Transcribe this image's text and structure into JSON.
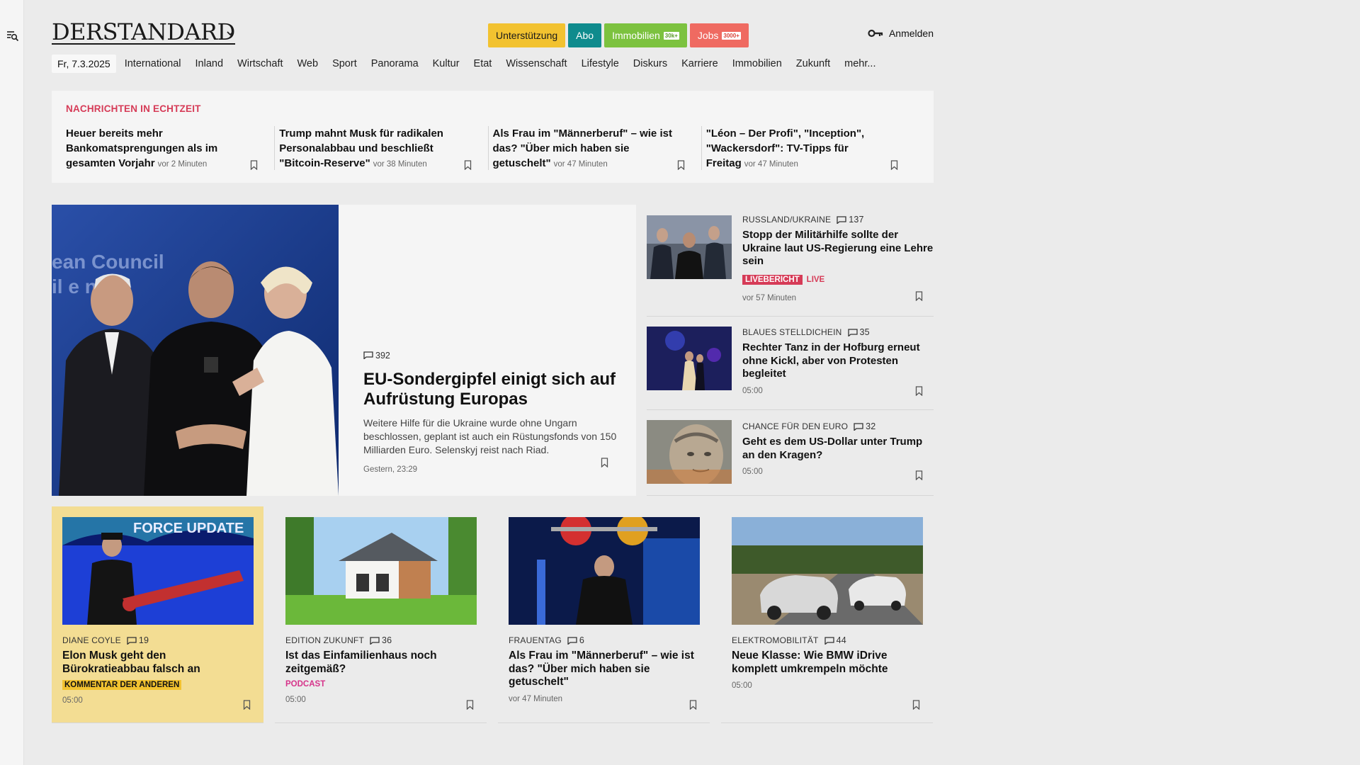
{
  "header": {
    "logo": "DERSTANDARD",
    "promos": {
      "support": "Unterstützung",
      "abo": "Abo",
      "immobilien": "Immobilien",
      "immobilien_badge": "30k+",
      "jobs": "Jobs",
      "jobs_badge": "3000+"
    },
    "login": "Anmelden"
  },
  "nav": {
    "date": "Fr, 7.3.2025",
    "items": [
      "International",
      "Inland",
      "Wirtschaft",
      "Web",
      "Sport",
      "Panorama",
      "Kultur",
      "Etat",
      "Wissenschaft",
      "Lifestyle",
      "Diskurs",
      "Karriere",
      "Immobilien",
      "Zukunft",
      "mehr..."
    ]
  },
  "ticker": {
    "title": "NACHRICHTEN IN ECHTZEIT",
    "items": [
      {
        "title": "Heuer bereits mehr Bankomatsprengungen als im gesamten Vorjahr",
        "time": "vor 2 Minuten"
      },
      {
        "title": "Trump mahnt Musk für radikalen Personalabbau und beschließt \"Bitcoin-Reserve\"",
        "time": "vor 38 Minuten"
      },
      {
        "title": "Als Frau im \"Männerberuf\" – wie ist das? \"Über mich haben sie getuschelt\"",
        "time": "vor 47 Minuten"
      },
      {
        "title": "\"Léon – Der Profi\", \"Inception\", \"Wackersdorf\": TV-Tipps für Freitag",
        "time": "vor 47 Minuten"
      }
    ]
  },
  "hero": {
    "comments": "392",
    "title": "EU-Sondergipfel einigt sich auf Aufrüstung Europas",
    "teaser": "Weitere Hilfe für die Ukraine wurde ohne Ungarn beschlossen, geplant ist auch ein Rüstungsfonds von 150 Milliarden Euro. Selenskyj reist nach Riad.",
    "time": "Gestern, 23:29",
    "image_text": "ean Council\nil e n"
  },
  "side": [
    {
      "kicker": "RUSSLAND/UKRAINE",
      "comments": "137",
      "title": "Stopp der Militärhilfe sollte der Ukraine laut US-Regierung eine Lehre sein",
      "badge": "LIVEBERICHT",
      "live": "LIVE",
      "time": "vor 57 Minuten"
    },
    {
      "kicker": "BLAUES STELLDICHEIN",
      "comments": "35",
      "title": "Rechter Tanz in der Hofburg erneut ohne Kickl, aber von Protesten begleitet",
      "time": "05:00"
    },
    {
      "kicker": "CHANCE FÜR DEN EURO",
      "comments": "32",
      "title": "Geht es dem US-Dollar unter Trump an den Kragen?",
      "time": "05:00"
    }
  ],
  "cards": [
    {
      "kicker": "DIANE COYLE",
      "comments": "19",
      "title": "Elon Musk geht den Bürokratieabbau falsch an",
      "tag": "KOMMENTAR DER ANDEREN",
      "time": "05:00",
      "image_text": "FORCE UPDATE"
    },
    {
      "kicker": "EDITION ZUKUNFT",
      "comments": "36",
      "title": "Ist das Einfamilienhaus noch zeitgemäß?",
      "tag": "PODCAST",
      "time": "05:00"
    },
    {
      "kicker": "FRAUENTAG",
      "comments": "6",
      "title": "Als Frau im \"Männerberuf\" – wie ist das? \"Über mich haben sie getuschelt\"",
      "time": "vor 47 Minuten"
    },
    {
      "kicker": "ELEKTROMOBILITÄT",
      "comments": "44",
      "title": "Neue Klasse: Wie BMW iDrive komplett umkrempeln möchte",
      "time": "05:00"
    }
  ],
  "colors": {
    "accent_red": "#d63b57",
    "support_yellow": "#f2c230",
    "abo_teal": "#0f8b8d",
    "immo_green": "#7cc23f",
    "jobs_red": "#ef6a61",
    "podcast_pink": "#d6338a",
    "highlight_card": "#f3dd93"
  }
}
